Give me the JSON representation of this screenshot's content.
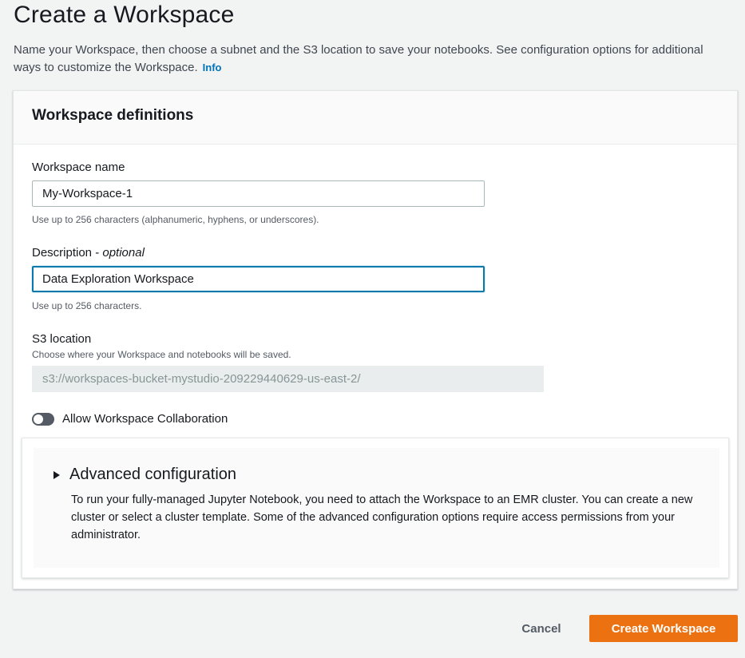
{
  "page": {
    "title": "Create a Workspace",
    "description": "Name your Workspace, then choose a subnet and the S3 location to save your notebooks. See configuration options for additional ways to customize the Workspace.",
    "info_link": "Info"
  },
  "panel": {
    "title": "Workspace definitions",
    "workspace_name": {
      "label": "Workspace name",
      "value": "My-Workspace-1",
      "hint": "Use up to 256 characters (alphanumeric, hyphens, or underscores)."
    },
    "description": {
      "label": "Description - ",
      "label_optional": "optional",
      "value": "Data Exploration Workspace",
      "hint": "Use up to 256 characters."
    },
    "s3_location": {
      "label": "S3 location",
      "hint": "Choose where your Workspace and notebooks will be saved.",
      "value": "s3://workspaces-bucket-mystudio-209229440629-us-east-2/"
    },
    "collaboration": {
      "label": "Allow Workspace Collaboration",
      "enabled": false
    },
    "advanced": {
      "title": "Advanced configuration",
      "text": "To run your fully-managed Jupyter Notebook, you need to attach the Workspace to an EMR cluster. You can create a new cluster or select a cluster template. Some of the advanced configuration options require access permissions from your administrator."
    }
  },
  "actions": {
    "cancel_label": "Cancel",
    "create_label": "Create Workspace"
  },
  "colors": {
    "primary_button": "#ec7211",
    "link": "#0073bb",
    "focus_border": "#0a78a8"
  }
}
